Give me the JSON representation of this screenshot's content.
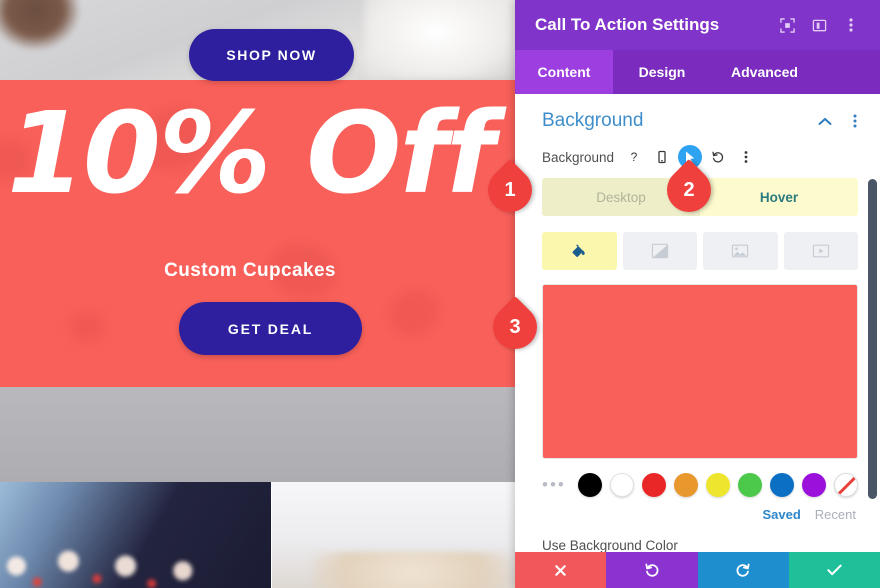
{
  "preview": {
    "shop_now_label": "SHOP NOW",
    "headline": "10% Off",
    "subline": "Custom Cupcakes",
    "get_deal_label": "GET DEAL",
    "cta_background_color": "#f9605a",
    "button_color": "#2d1f9e"
  },
  "modal": {
    "title": "Call To Action Settings",
    "header_icons": [
      {
        "name": "fullscreen-icon",
        "glyph": "expand"
      },
      {
        "name": "layout-view-icon",
        "glyph": "panel"
      },
      {
        "name": "more-options-icon",
        "glyph": "kebab"
      }
    ],
    "tabs": [
      {
        "label": "Content",
        "active": true
      },
      {
        "label": "Design",
        "active": false
      },
      {
        "label": "Advanced",
        "active": false
      }
    ],
    "section": {
      "title": "Background",
      "collapse_icon": "chevron-up-icon",
      "options_icon": "kebab-icon"
    },
    "field": {
      "label": "Background",
      "controls": [
        {
          "name": "help-icon",
          "glyph": "?",
          "active": false
        },
        {
          "name": "responsive-mobile-icon",
          "glyph": "phone",
          "active": false
        },
        {
          "name": "hover-cursor-icon",
          "glyph": "cursor",
          "active": true
        },
        {
          "name": "reset-icon",
          "glyph": "undo",
          "active": false
        },
        {
          "name": "field-options-icon",
          "glyph": "kebab",
          "active": false
        }
      ]
    },
    "hover_toggle": {
      "desktop_label": "Desktop",
      "hover_label": "Hover",
      "active": "Hover",
      "desktop_bg": "#eeeec9",
      "hover_bg": "#fdfbce",
      "hover_text_color": "#2a7a7f"
    },
    "background_types": [
      {
        "name": "background-color-tab",
        "icon": "paint-bucket-icon",
        "active": true
      },
      {
        "name": "background-gradient-tab",
        "icon": "gradient-icon",
        "active": false
      },
      {
        "name": "background-image-tab",
        "icon": "image-icon",
        "active": false
      },
      {
        "name": "background-video-tab",
        "icon": "video-icon",
        "active": false
      }
    ],
    "color_preview": {
      "name": "color-preview-swatch",
      "color": "#f9605a"
    },
    "swatches": [
      {
        "name": "swatch-more",
        "color": ""
      },
      {
        "name": "swatch-black",
        "color": "#000000"
      },
      {
        "name": "swatch-white",
        "color": "#ffffff"
      },
      {
        "name": "swatch-red",
        "color": "#ea2727"
      },
      {
        "name": "swatch-orange",
        "color": "#e8982c"
      },
      {
        "name": "swatch-yellow",
        "color": "#eee62e"
      },
      {
        "name": "swatch-green",
        "color": "#4cc94a"
      },
      {
        "name": "swatch-blue",
        "color": "#0b6fc4"
      },
      {
        "name": "swatch-purple",
        "color": "#9b10da"
      },
      {
        "name": "swatch-none",
        "color": "transparent"
      }
    ],
    "palette_links": {
      "saved": "Saved",
      "recent": "Recent"
    },
    "use_background_color_label": "Use Background Color",
    "footer_buttons": [
      {
        "name": "cancel-button",
        "icon": "close-icon",
        "color": "#f0585b"
      },
      {
        "name": "undo-button",
        "icon": "undo-icon",
        "color": "#8b33d1"
      },
      {
        "name": "redo-button",
        "icon": "redo-icon",
        "color": "#1f8ecf"
      },
      {
        "name": "save-button",
        "icon": "checkmark-icon",
        "color": "#1fbf9a"
      }
    ]
  },
  "annotations": [
    {
      "number": "1"
    },
    {
      "number": "2"
    },
    {
      "number": "3"
    }
  ]
}
